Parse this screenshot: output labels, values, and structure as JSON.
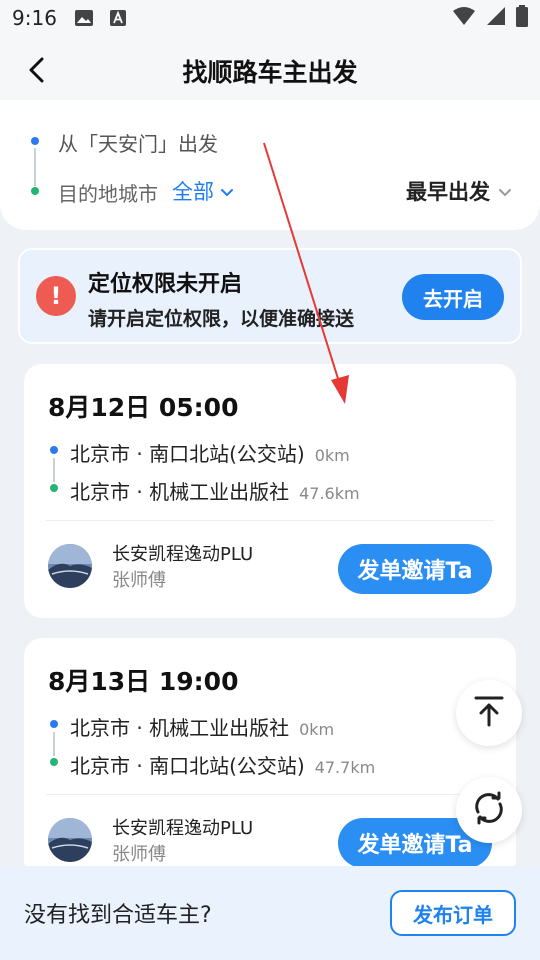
{
  "status_bar": {
    "time": "9:16"
  },
  "header": {
    "title": "找顺路车主出发"
  },
  "route": {
    "from": "从「天安门」出发",
    "dest_label": "目的地城市",
    "dest_value": "全部",
    "sort_label": "最早出发"
  },
  "permission": {
    "title": "定位权限未开启",
    "desc": "请开启定位权限，以便准确接送",
    "button": "去开启"
  },
  "trips": [
    {
      "time": "8月12日 05:00",
      "start": "北京市 · 南口北站(公交站)",
      "start_dist": "0km",
      "end": "北京市 · 机械工业出版社",
      "end_dist": "47.6km",
      "car": "长安凯程逸动PLU",
      "driver": "张师傅",
      "invite": "发单邀请Ta"
    },
    {
      "time": "8月13日 19:00",
      "start": "北京市 · 机械工业出版社",
      "start_dist": "0km",
      "end": "北京市 · 南口北站(公交站)",
      "end_dist": "47.7km",
      "car": "长安凯程逸动PLU",
      "driver": "张师傅",
      "invite": "发单邀请Ta"
    }
  ],
  "bottom": {
    "prompt": "没有找到合适车主?",
    "button": "发布订单"
  },
  "colors": {
    "accent": "#1f82ef",
    "dot_start": "#2b79f0",
    "dot_end": "#22b573",
    "alert": "#ee5b52",
    "annotation": "#e53935"
  },
  "icons": [
    "back-arrow-icon",
    "chevron-down-icon",
    "alert-icon",
    "scroll-top-icon",
    "refresh-icon"
  ]
}
